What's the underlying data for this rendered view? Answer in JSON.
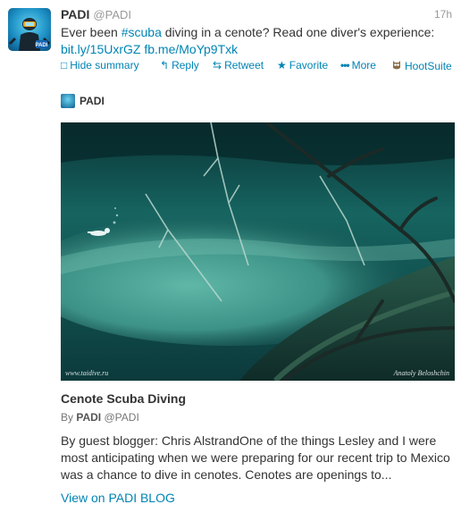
{
  "tweet": {
    "author_name": "PADI",
    "author_handle": "@PADI",
    "time": "17h",
    "text_before": "Ever been ",
    "hashtag": "#scuba",
    "text_after": " diving in a cenote? Read one diver's experience:",
    "link1": "bit.ly/15UxrGZ",
    "link2": "fb.me/MoYp9Txk"
  },
  "actions": {
    "hide_summary": "Hide summary",
    "reply": "Reply",
    "retweet": "Retweet",
    "favorite": "Favorite",
    "more": "More",
    "hootsuite": "HootSuite"
  },
  "icons": {
    "hide_summary": "document-icon",
    "reply": "reply-arrow-icon",
    "retweet": "retweet-icon",
    "favorite": "star-icon",
    "more": "dots-icon",
    "hootsuite": "owl-icon"
  },
  "card": {
    "author": "PADI",
    "watermark_left": "www.taidive.ru",
    "watermark_right": "Anatoly Beloshchin",
    "title": "Cenote Scuba Diving",
    "by_label": "By",
    "by_name": "PADI",
    "by_handle": "@PADI",
    "summary": "By guest blogger: Chris AlstrandOne of the things Lesley and I were most anticipating when we were preparing for our recent trip to Mexico was a chance to dive in cenotes. Cenotes are openings to...",
    "view_link": "View on PADI BLOG"
  },
  "colors": {
    "link": "#0084b4",
    "text": "#333333",
    "muted": "#999999"
  }
}
